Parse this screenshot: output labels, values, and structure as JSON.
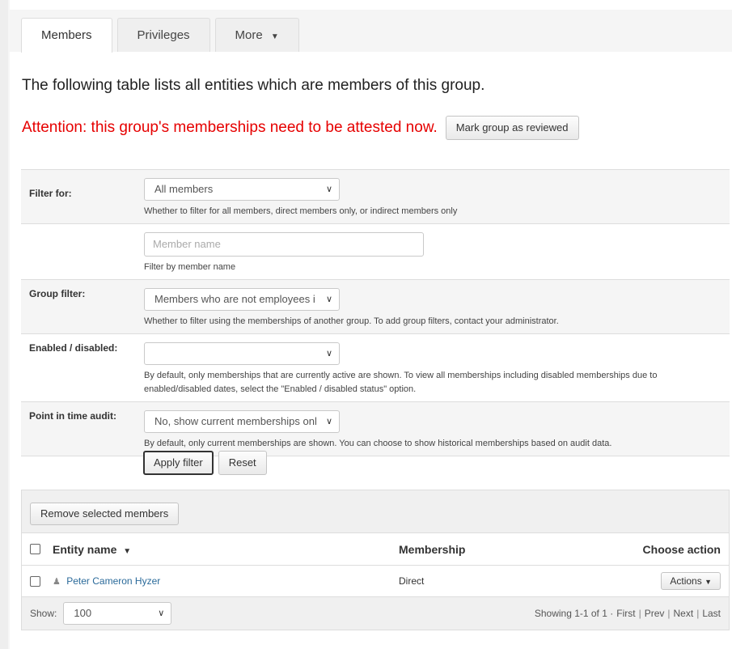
{
  "tabs": [
    {
      "label": "Members",
      "active": true
    },
    {
      "label": "Privileges",
      "active": false
    },
    {
      "label": "More",
      "active": false
    }
  ],
  "intro_text": "The following table lists all entities which are members of this group.",
  "attention": {
    "text": "Attention: this group's memberships need to be attested now.",
    "button": "Mark group as reviewed",
    "color": "#e60000"
  },
  "filters": {
    "filter_for": {
      "label": "Filter for:",
      "selected": "All members",
      "help": "Whether to filter for all members, direct members only, or indirect members only"
    },
    "member_name": {
      "placeholder": "Member name",
      "help": "Filter by member name"
    },
    "group_filter": {
      "label": "Group filter:",
      "selected": "Members who are not employees i",
      "help": "Whether to filter using the memberships of another group. To add group filters, contact your administrator."
    },
    "enabled": {
      "label": "Enabled / disabled:",
      "selected": "",
      "help": "By default, only memberships that are currently active are shown. To view all memberships including disabled memberships due to enabled/disabled dates, select the \"Enabled / disabled status\" option."
    },
    "point_in_time": {
      "label": "Point in time audit:",
      "selected": "No, show current memberships onl",
      "help": "By default, only current memberships are shown. You can choose to show historical memberships based on audit data."
    },
    "apply_label": "Apply filter",
    "reset_label": "Reset"
  },
  "members_table": {
    "remove_button": "Remove selected members",
    "headers": {
      "entity": "Entity name",
      "membership": "Membership",
      "action": "Choose action"
    },
    "rows": [
      {
        "name": "Peter Cameron Hyzer",
        "membership": "Direct",
        "action": "Actions"
      }
    ],
    "footer": {
      "show_label": "Show:",
      "page_size": "100",
      "showing": "Showing 1-1 of 1 ·",
      "first": "First",
      "prev": "Prev",
      "next": "Next",
      "last": "Last",
      "sep": "|"
    }
  },
  "colors": {
    "link": "#2a6a9a",
    "alert": "#e60000"
  }
}
